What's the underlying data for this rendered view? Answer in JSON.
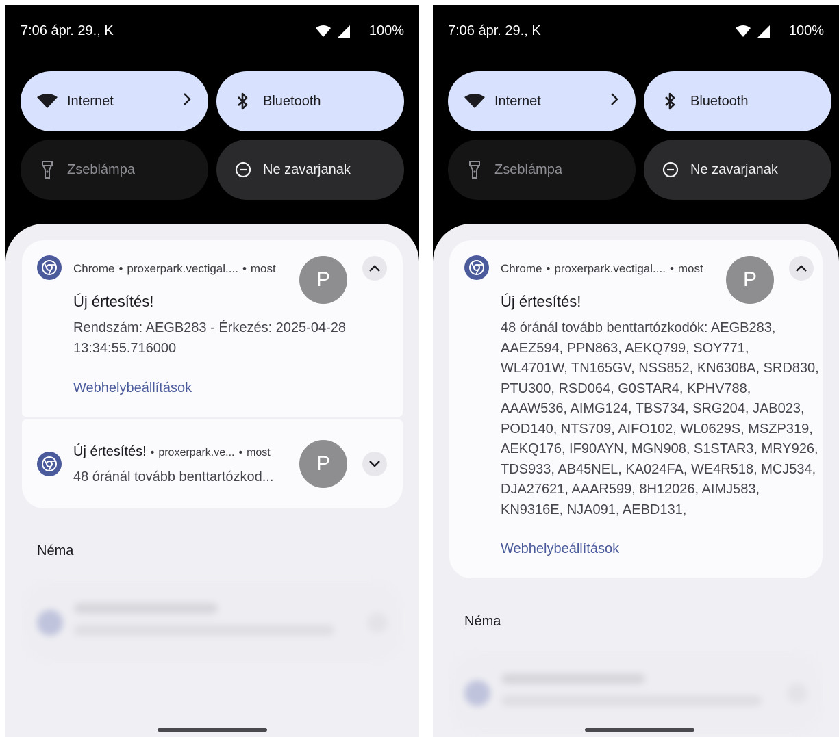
{
  "status": {
    "time": "7:06 ápr. 29., K",
    "battery": "100%"
  },
  "tiles": {
    "internet": "Internet",
    "bluetooth": "Bluetooth",
    "flashlight": "Zseblámpa",
    "dnd": "Ne zavarjanak"
  },
  "notif": {
    "app": "Chrome",
    "site": "proxerpark.vectigal....",
    "site_short": "proxerpark.ve...",
    "time": "most",
    "avatar": "P",
    "title": "Új értesítés!",
    "body_left": "Rendszám: AEGB283 - Érkezés: 2025-04-28 13:34:55.716000",
    "collapsed_preview": "48 óránál tovább benttartózkod...",
    "body_right": "48 óránál tovább benttartózkodók: AEGB283, AAEZ594, PPN863, AEKQ799, SOY771, WL4701W, TN165GV, NSS852, KN6308A, SRD830, PTU300, RSD064, G0STAR4, KPHV788, AAAW536, AIMG124, TBS734, SRG204, JAB023, POD140, NTS709, AIFO102, WL0629S, MSZP319, AEKQ176, IF90AYN, MGN908, S1STAR3, MRY926, TDS933, AB45NEL, KA024FA, WE4R518, MCJ534, DJA27621, AAAR599, 8H12026, AIMJ583, KN9316E, NJA091, AEBD131,",
    "settings_link": "Webhelybeállítások"
  },
  "silent_label": "Néma",
  "icons": [
    "wifi-icon",
    "signal-icon",
    "bluetooth-icon",
    "flashlight-icon",
    "dnd-icon",
    "chevron-right-icon",
    "chrome-icon",
    "expand-less-icon",
    "expand-more-icon"
  ]
}
